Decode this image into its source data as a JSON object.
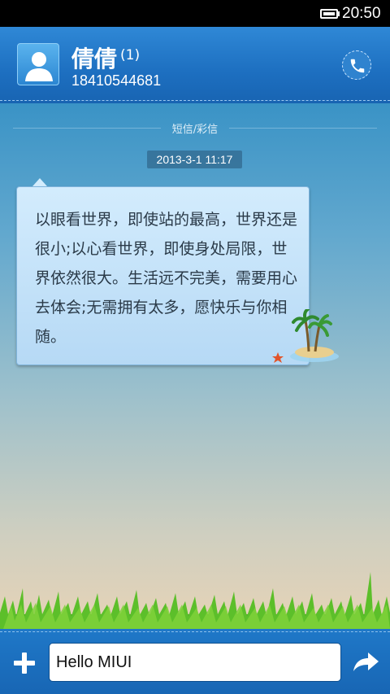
{
  "status_bar": {
    "time": "20:50"
  },
  "header": {
    "contact_name": "倩倩",
    "unread_count": "(1)",
    "phone_number": "18410544681"
  },
  "conversation": {
    "channel_label": "短信/彩信",
    "timestamp": "2013-3-1 11:17",
    "message": "以眼看世界，即使站的最高，世界还是很小;以心看世界，即使身处局限，世界依然很大。生活远不完美，需要用心去体会;无需拥有太多，愿快乐与你相随。"
  },
  "compose": {
    "input_value": "Hello MIUI"
  },
  "icons": {
    "avatar": "person-icon",
    "call": "phone-icon",
    "add": "plus-icon",
    "send": "forward-arrow-icon"
  }
}
